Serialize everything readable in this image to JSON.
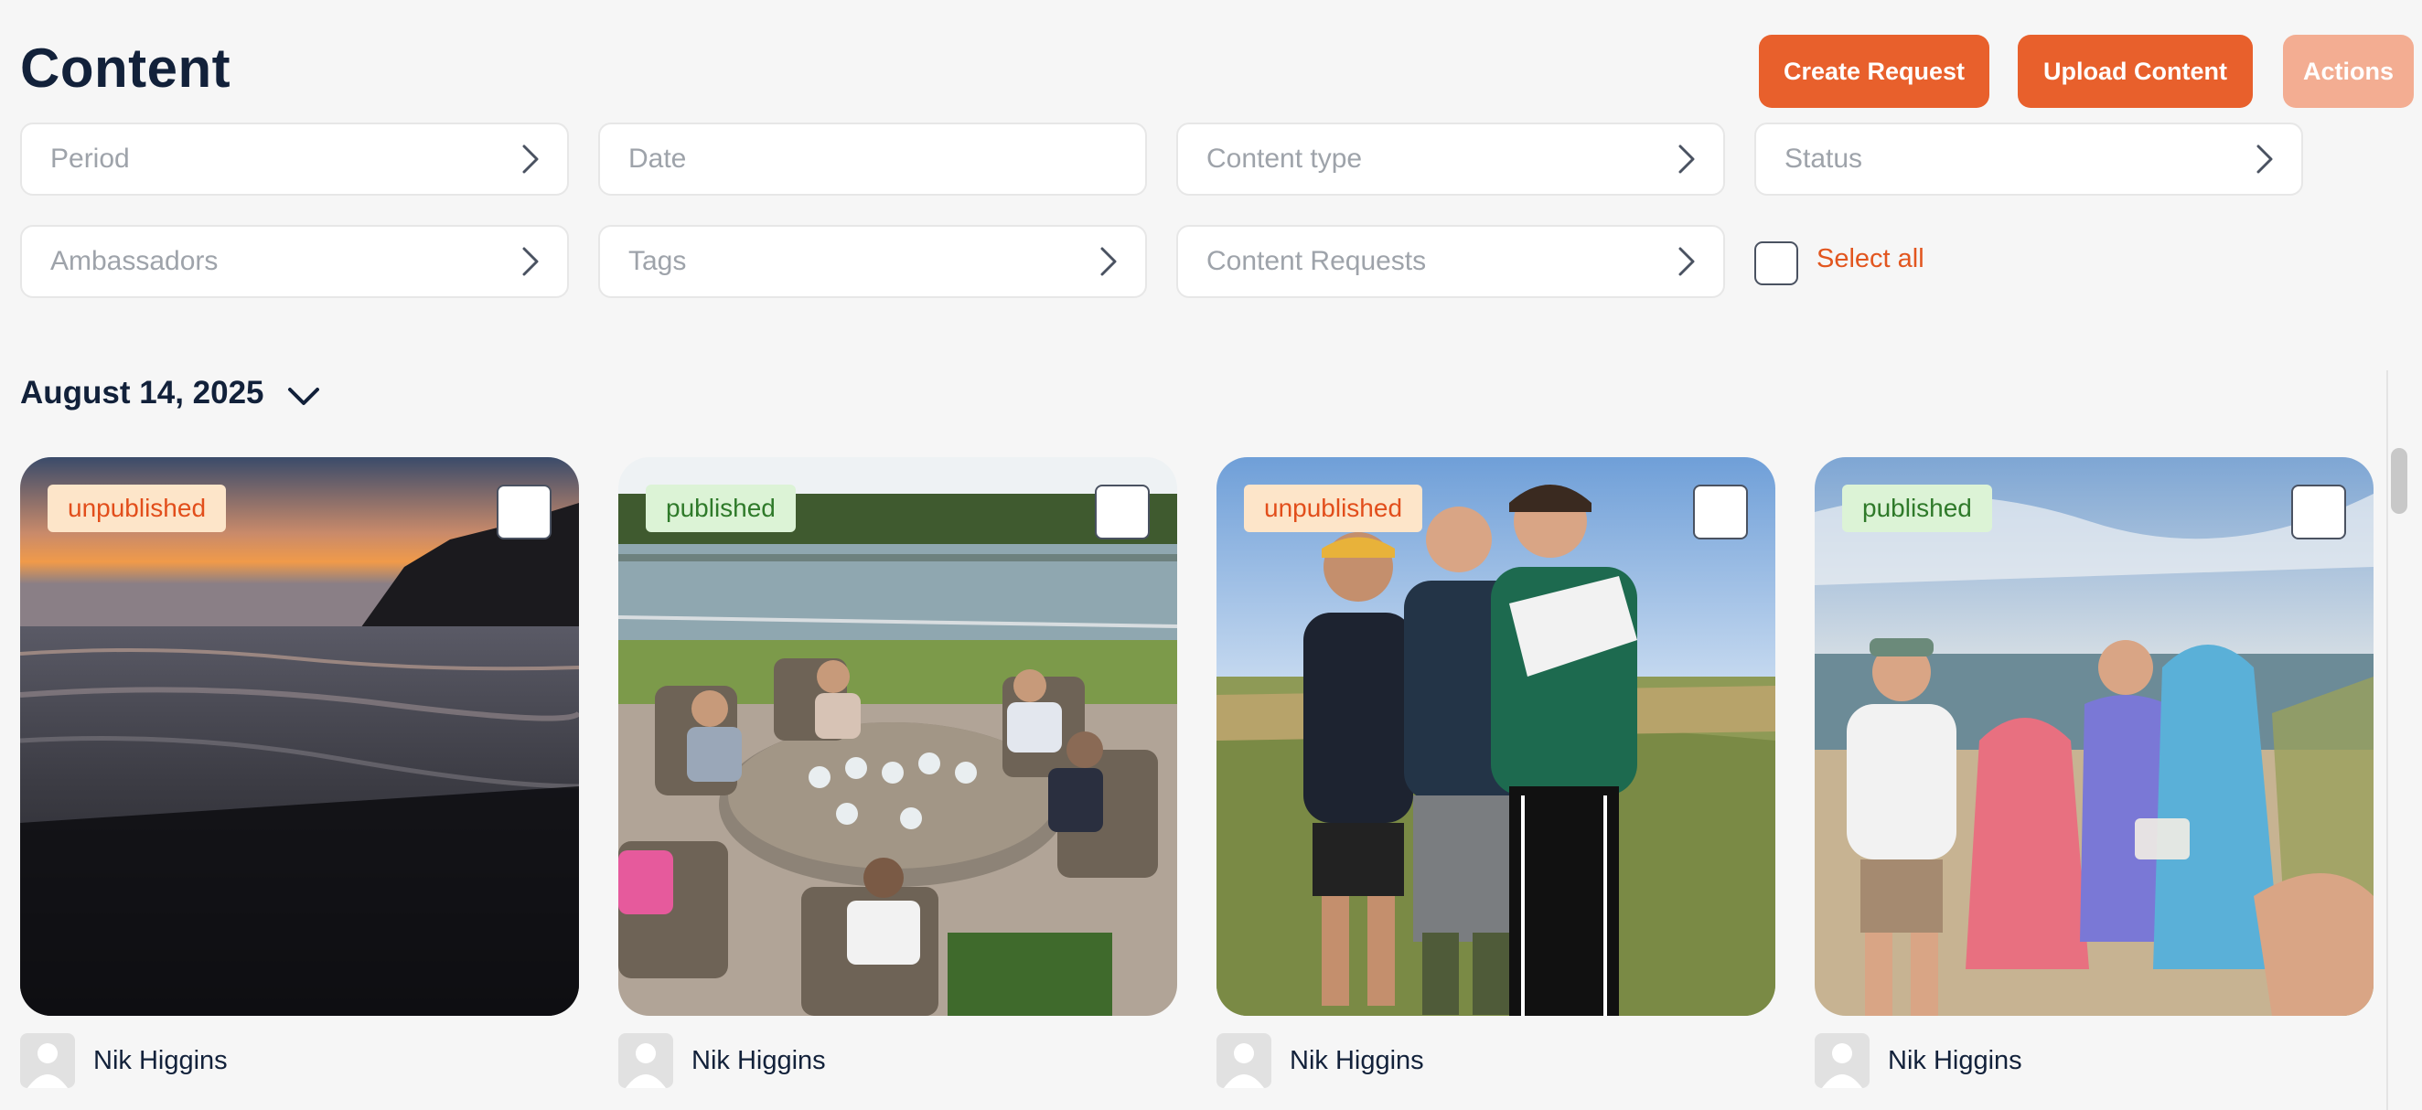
{
  "page": {
    "title": "Content"
  },
  "toolbar": {
    "create_request": "Create Request",
    "upload_content": "Upload Content",
    "actions": "Actions"
  },
  "filters": {
    "period": "Period",
    "date": "Date",
    "content_type": "Content type",
    "status": "Status",
    "ambassadors": "Ambassadors",
    "tags": "Tags",
    "content_requests": "Content Requests",
    "select_all": "Select all"
  },
  "group": {
    "date": "August 14, 2025"
  },
  "cards": [
    {
      "status": "unpublished",
      "author": "Nik Higgins",
      "icon": "sunset-beach-photo"
    },
    {
      "status": "published",
      "author": "Nik Higgins",
      "icon": "terrace-dinner-photo"
    },
    {
      "status": "unpublished",
      "author": "Nik Higgins",
      "icon": "three-friends-photo"
    },
    {
      "status": "published",
      "author": "Nik Higgins",
      "icon": "beach-towels-photo"
    }
  ],
  "colors": {
    "accent": "#e8602c",
    "accent_disabled": "#f3ad92",
    "unpublished_bg": "#fde5c9",
    "unpublished_text": "#e24e1b",
    "published_bg": "#dcf3d6",
    "published_text": "#2f7a2a"
  }
}
